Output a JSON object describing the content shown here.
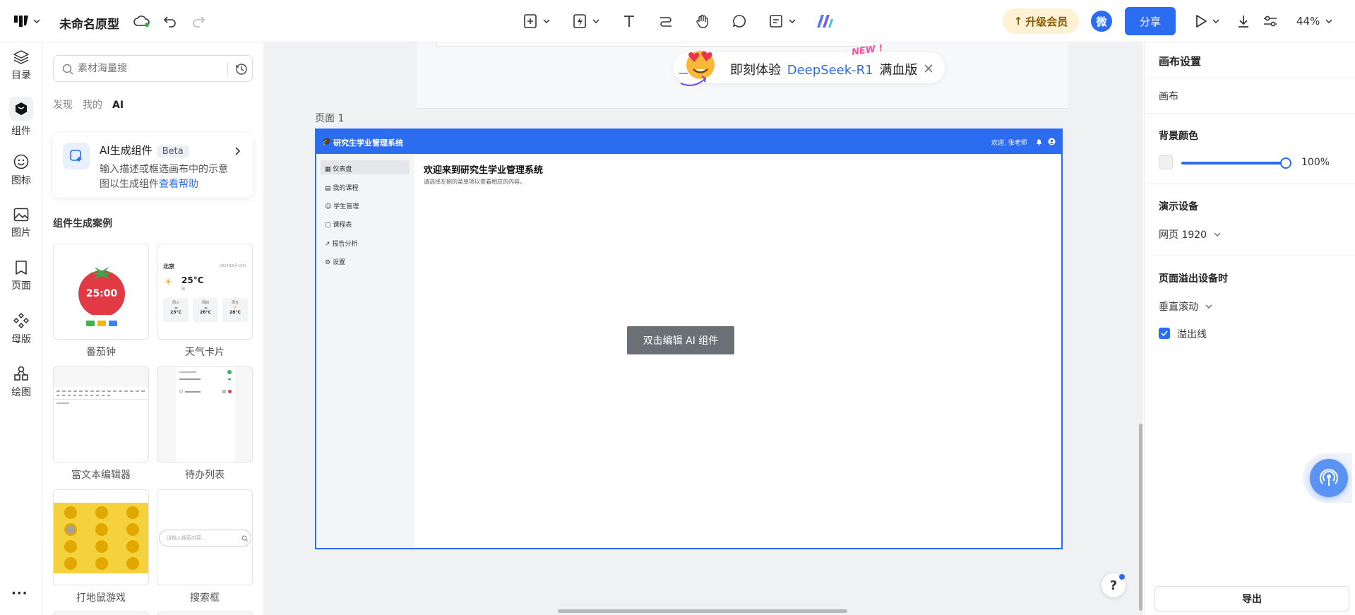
{
  "header": {
    "doc_title": "未命名原型",
    "upgrade_label": "升级会员",
    "user_initial": "微",
    "share_label": "分享",
    "zoom": "44%"
  },
  "left_nav": [
    {
      "label": "目录",
      "icon": "layers-icon"
    },
    {
      "label": "组件",
      "icon": "component-icon"
    },
    {
      "label": "图标",
      "icon": "smiley-icon"
    },
    {
      "label": "图片",
      "icon": "image-icon"
    },
    {
      "label": "页面",
      "icon": "page-icon"
    },
    {
      "label": "母版",
      "icon": "master-icon"
    },
    {
      "label": "绘图",
      "icon": "shapes-icon"
    }
  ],
  "more_label": "···",
  "panel": {
    "search_placeholder": "素材海量搜",
    "tabs": [
      "发现",
      "我的",
      "AI"
    ],
    "ai_card": {
      "title": "AI生成组件",
      "badge": "Beta",
      "desc_line1": "输入描述或框选画布中的示意",
      "desc_line2": "图以生成组件",
      "help_link": "查看帮助"
    },
    "examples_title": "组件生成案例",
    "examples": [
      "番茄钟",
      "天气卡片",
      "富文本编辑器",
      "待办列表",
      "打地鼠游戏",
      "搜索框"
    ],
    "tomato_time": "25:00",
    "weather": {
      "city": "北京",
      "date": "2024年6月18日",
      "temp": "25°C",
      "cond": "晴",
      "days": [
        {
          "name": "周三",
          "temp": "23°C"
        },
        {
          "name": "周四",
          "temp": "26°C"
        },
        {
          "name": "周五",
          "temp": "28°C"
        }
      ]
    },
    "search_box_placeholder": "请输入搜索内容..."
  },
  "canvas": {
    "promo": {
      "text": "即刻体验",
      "brand": "DeepSeek-R1",
      "suffix": "满血版",
      "new_tag": "NEW !"
    },
    "page_label": "页面 1",
    "frame": {
      "app_title": "研究生学业管理系统",
      "welcome_user": "欢迎, 张老师",
      "menu": [
        "仪表盘",
        "我的课程",
        "学生管理",
        "课程表",
        "报告分析",
        "设置"
      ],
      "heading": "欢迎来到研究生学业管理系统",
      "sub": "请选择左侧的菜单项以查看相应的内容。",
      "edit_hint": "双击编辑 AI 组件"
    },
    "help_label": "?"
  },
  "right_panel": {
    "canvas_settings": "画布设置",
    "canvas_label": "画布",
    "bg_color_title": "背景颜色",
    "bg_opacity": "100%",
    "bg_opacity_value": 1.0,
    "device_title": "演示设备",
    "device_value": "网页 1920",
    "overflow_title": "页面溢出设备时",
    "overflow_value": "垂直滚动",
    "overflow_line_label": "溢出线",
    "export_label": "导出"
  },
  "colors": {
    "accent": "#2b6cf0",
    "frame_header": "#2b6cf0",
    "upgrade_bg": "#fdf1d6",
    "tomato": "#e23a45"
  }
}
